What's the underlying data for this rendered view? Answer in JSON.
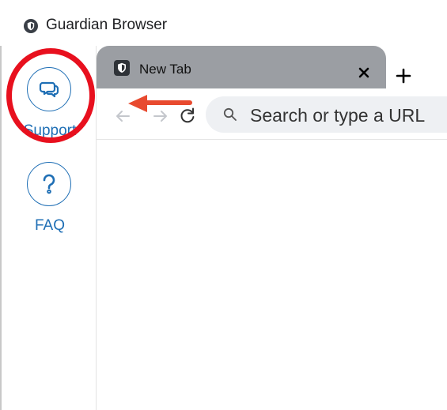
{
  "window": {
    "title": "Guardian Browser"
  },
  "side_panel": {
    "items": [
      {
        "label": "Support",
        "icon": "chat-bubbles-icon"
      },
      {
        "label": "FAQ",
        "icon": "question-mark-icon"
      }
    ]
  },
  "tabs": [
    {
      "title": "New Tab",
      "icon": "shield-icon",
      "active": true
    }
  ],
  "toolbar": {
    "back_icon": "back-arrow-icon",
    "forward_icon": "forward-arrow-icon",
    "reload_icon": "reload-icon",
    "url_placeholder": "Search or type a URL"
  },
  "colors": {
    "accent": "#1f6fb5",
    "annotation": "#e8101e",
    "tab_background": "#9b9ea3",
    "urlbar_background": "#eef0f3"
  }
}
